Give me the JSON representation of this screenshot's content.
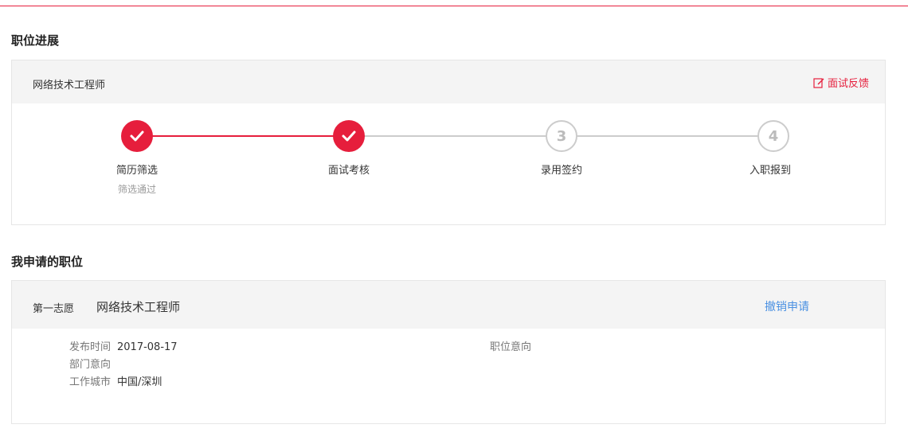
{
  "section_progress": {
    "title": "职位进展"
  },
  "progress_card": {
    "job_title": "网络技术工程师",
    "feedback_label": "面试反馈",
    "steps": [
      {
        "label": "简历筛选",
        "sub": "筛选通过",
        "status": "done"
      },
      {
        "label": "面试考核",
        "sub": "",
        "status": "done"
      },
      {
        "label": "录用签约",
        "sub": "",
        "status": "todo",
        "number": "3"
      },
      {
        "label": "入职报到",
        "sub": "",
        "status": "todo",
        "number": "4"
      }
    ]
  },
  "section_applied": {
    "title": "我申请的职位"
  },
  "application": {
    "choice": "第一志愿",
    "job_title": "网络技术工程师",
    "cancel_label": "撤销申请",
    "fields": {
      "publish_time_label": "发布时间",
      "publish_time_value": "2017-08-17",
      "department_label": "部门意向",
      "city_label": "工作城市",
      "city_value": "中国/深圳",
      "position_label": "职位意向"
    }
  },
  "colors": {
    "accent": "#e61e3c",
    "link": "#4a90e2",
    "inactive": "#cccccc"
  }
}
